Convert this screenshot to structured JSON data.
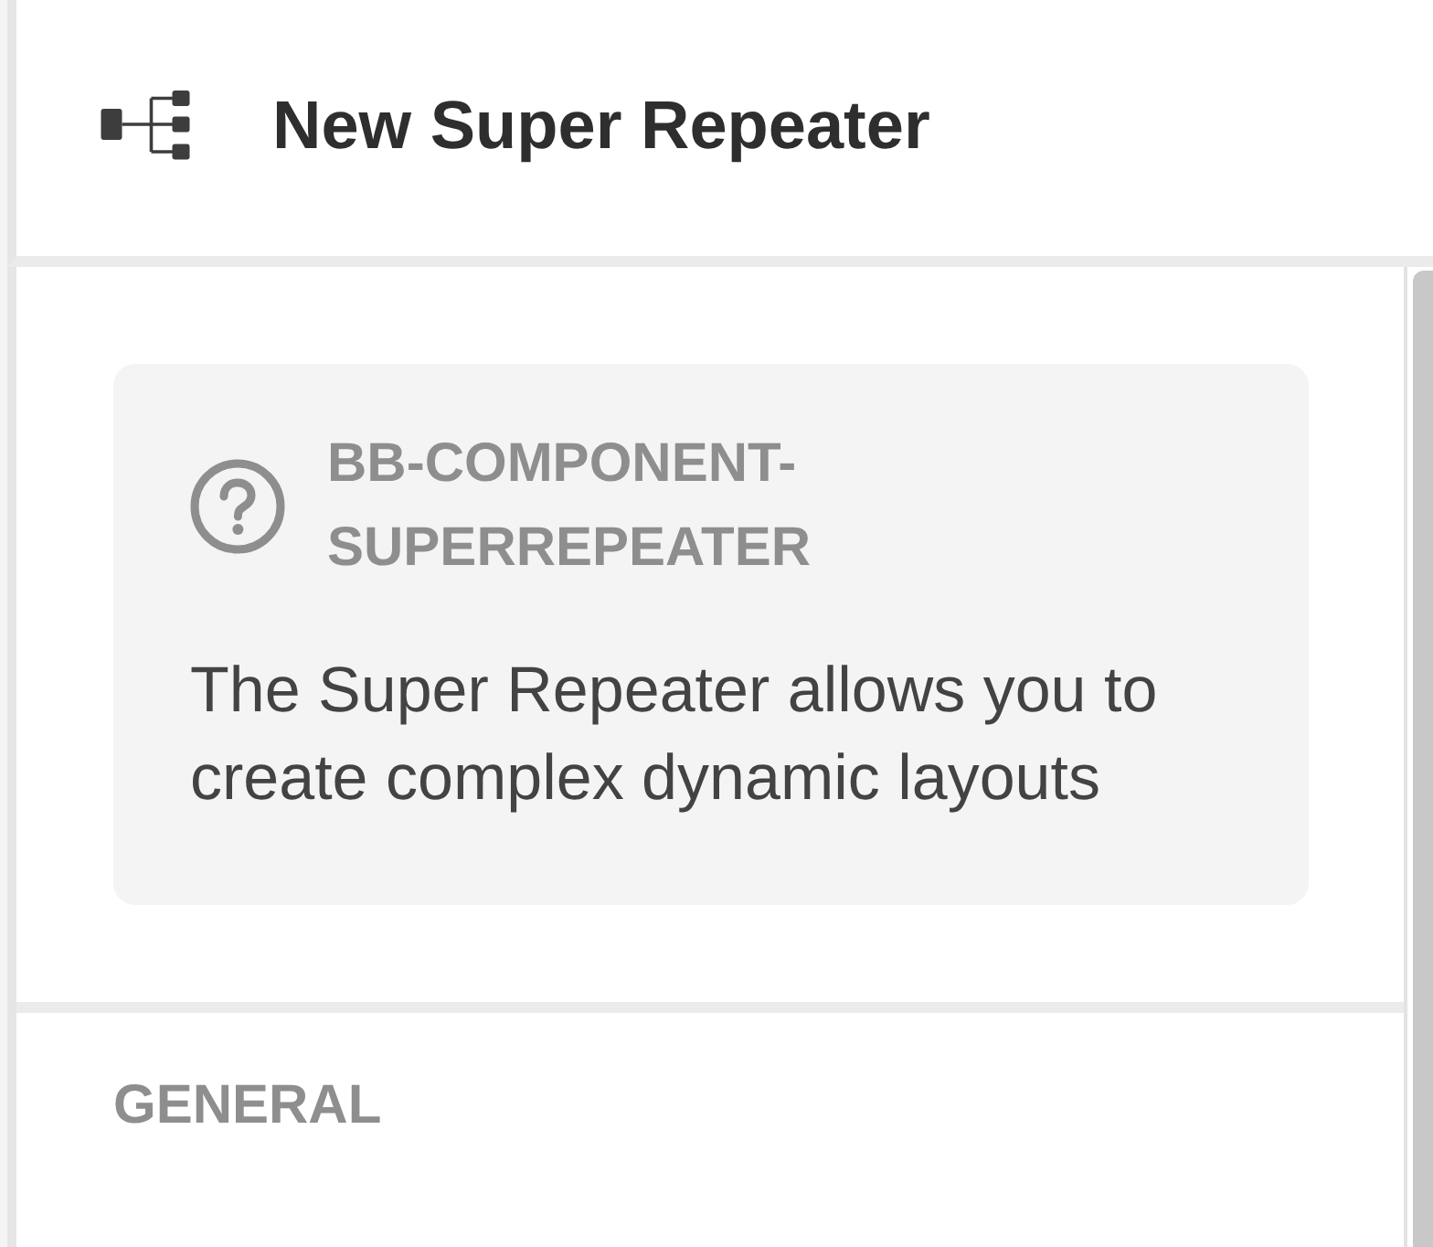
{
  "header": {
    "title": "New Super Repeater"
  },
  "info_card": {
    "title": "BB-COMPONENT-SUPERREPEATER",
    "description": "The Super Repeater allows you to create complex dynamic layouts"
  },
  "sections": [
    {
      "title": "GENERAL"
    }
  ]
}
